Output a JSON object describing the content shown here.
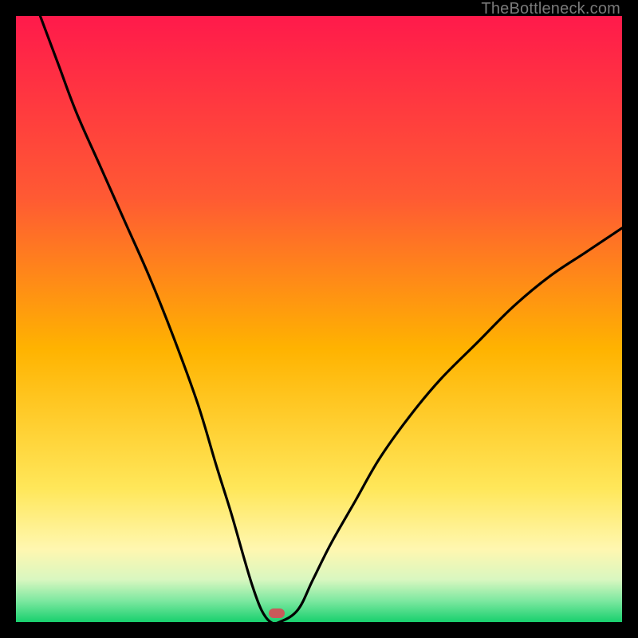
{
  "watermark": "TheBottleneck.com",
  "chart_data": {
    "type": "line",
    "title": "",
    "xlabel": "",
    "ylabel": "",
    "xlim": [
      0,
      100
    ],
    "ylim": [
      0,
      100
    ],
    "grid": false,
    "gradient_stops": [
      {
        "offset": 0,
        "color": "#ff1a4b"
      },
      {
        "offset": 0.3,
        "color": "#ff5a33"
      },
      {
        "offset": 0.55,
        "color": "#ffb300"
      },
      {
        "offset": 0.78,
        "color": "#ffe75a"
      },
      {
        "offset": 0.88,
        "color": "#fff7b0"
      },
      {
        "offset": 0.93,
        "color": "#d9f7c0"
      },
      {
        "offset": 0.965,
        "color": "#7de8a0"
      },
      {
        "offset": 1.0,
        "color": "#18d06e"
      }
    ],
    "series": [
      {
        "name": "bottleneck-curve",
        "x": [
          4,
          7,
          10,
          14,
          18,
          22,
          26,
          30,
          33,
          35.5,
          37.5,
          39,
          40.5,
          42,
          43.5,
          46.5,
          49,
          52,
          56,
          60,
          65,
          70,
          76,
          82,
          88,
          94,
          100
        ],
        "y": [
          100,
          92,
          84,
          75,
          66,
          57,
          47,
          36,
          26,
          18,
          11,
          6,
          2,
          0,
          0,
          2,
          7,
          13,
          20,
          27,
          34,
          40,
          46,
          52,
          57,
          61,
          65
        ]
      }
    ],
    "marker": {
      "x": 43,
      "y": 1.5,
      "color": "#c85a5a"
    }
  }
}
